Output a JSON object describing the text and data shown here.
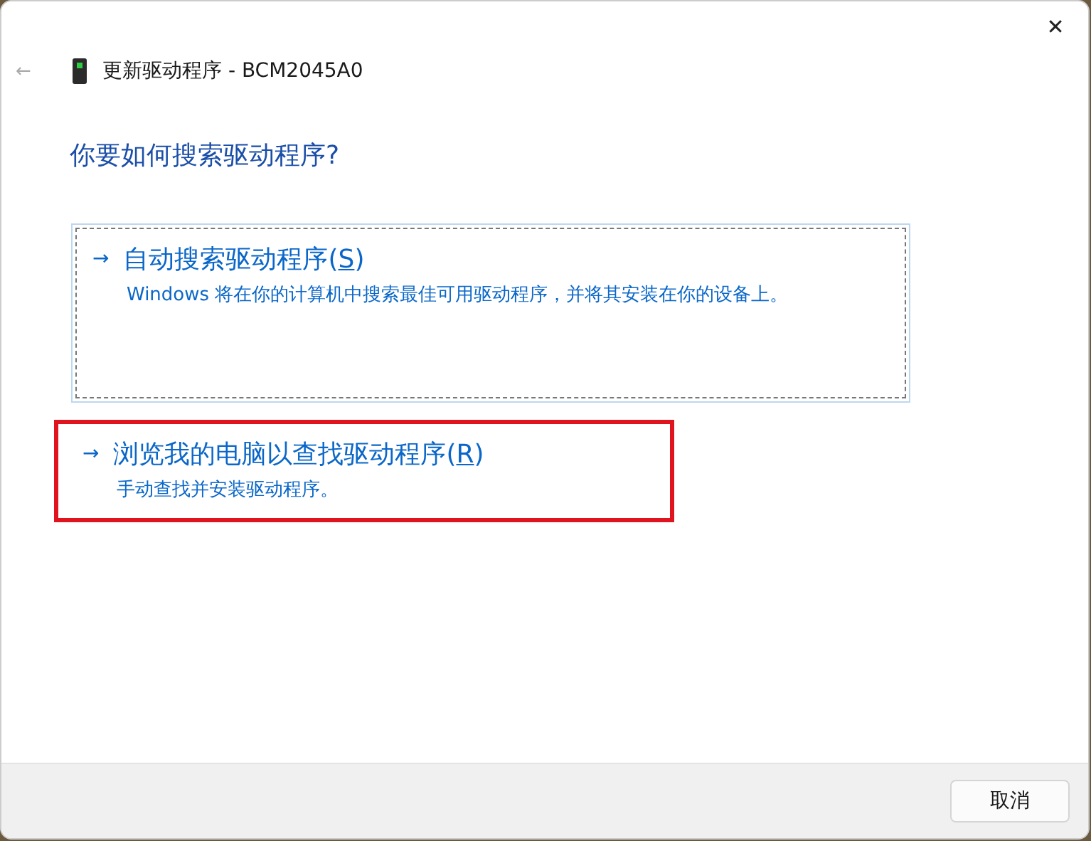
{
  "window": {
    "title": "更新驱动程序 - BCM2045A0",
    "close": "✕",
    "back": "←"
  },
  "heading": "你要如何搜索驱动程序?",
  "options": [
    {
      "title_before": "自动搜索驱动程序(",
      "access_key": "S",
      "title_after": ")",
      "description": "Windows 将在你的计算机中搜索最佳可用驱动程序，并将其安装在你的设备上。",
      "focused": true,
      "highlighted": false
    },
    {
      "title_before": "浏览我的电脑以查找驱动程序(",
      "access_key": "R",
      "title_after": ")",
      "description": "手动查找并安装驱动程序。",
      "focused": false,
      "highlighted": true
    }
  ],
  "arrow": "→",
  "buttons": [
    "取消"
  ]
}
